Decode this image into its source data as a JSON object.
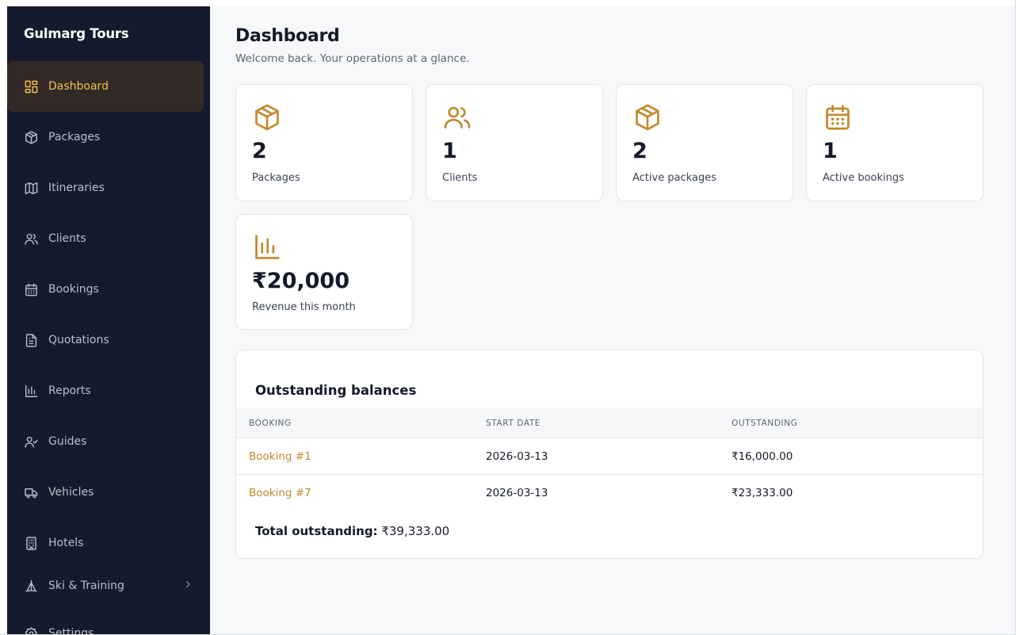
{
  "brand": "Gulmarg Tours",
  "sidebar": {
    "items": [
      {
        "label": "Dashboard",
        "icon": "dashboard-icon",
        "active": true
      },
      {
        "label": "Packages",
        "icon": "package-icon"
      },
      {
        "label": "Itineraries",
        "icon": "map-icon"
      },
      {
        "label": "Clients",
        "icon": "users-icon"
      },
      {
        "label": "Bookings",
        "icon": "calendar-icon"
      },
      {
        "label": "Quotations",
        "icon": "document-icon"
      },
      {
        "label": "Reports",
        "icon": "bar-chart-icon"
      },
      {
        "label": "Guides",
        "icon": "user-check-icon"
      },
      {
        "label": "Vehicles",
        "icon": "truck-icon"
      },
      {
        "label": "Hotels",
        "icon": "building-icon"
      },
      {
        "label": "Ski & Training",
        "icon": "ski-icon",
        "expandable": true
      },
      {
        "label": "Settings",
        "icon": "gear-icon"
      }
    ]
  },
  "header": {
    "title": "Dashboard",
    "subtitle": "Welcome back. Your operations at a glance."
  },
  "stats": [
    {
      "value": "2",
      "label": "Packages",
      "icon": "package-icon"
    },
    {
      "value": "1",
      "label": "Clients",
      "icon": "users-icon"
    },
    {
      "value": "2",
      "label": "Active packages",
      "icon": "package-icon"
    },
    {
      "value": "1",
      "label": "Active bookings",
      "icon": "calendar-icon"
    },
    {
      "value": "₹20,000",
      "label": "Revenue this month",
      "icon": "bar-chart-icon"
    }
  ],
  "outstanding": {
    "title": "Outstanding balances",
    "columns": [
      "BOOKING",
      "START DATE",
      "OUTSTANDING"
    ],
    "rows": [
      {
        "booking": "Booking #1",
        "start_date": "2026-03-13",
        "outstanding": "₹16,000.00"
      },
      {
        "booking": "Booking #7",
        "start_date": "2026-03-13",
        "outstanding": "₹23,333.00"
      }
    ],
    "total_label": "Total outstanding:",
    "total_value": "₹39,333.00"
  },
  "colors": {
    "sidebar_bg": "#151a2c",
    "active_bg": "#322a26",
    "active_text": "#f2c14e",
    "accent": "#c08a2e",
    "page_bg": "#f7f8fa"
  }
}
